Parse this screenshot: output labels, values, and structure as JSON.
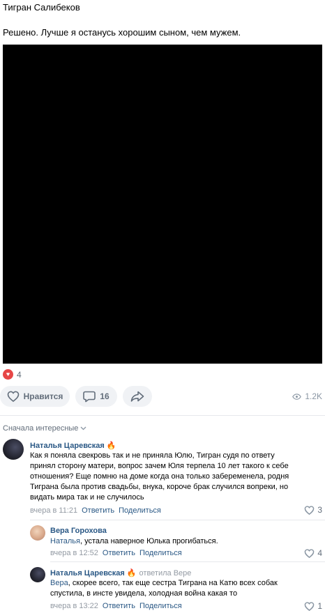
{
  "post": {
    "author": "Тигран Салибеков",
    "text": "Решено. Лучше я останусь хорошим сыном, чем мужем.",
    "reactions_count": "4",
    "like_label": "Нравится",
    "comments_count": "16",
    "views": "1.2K"
  },
  "comments_sort": "Сначала интересные",
  "comments": [
    {
      "name": "Наталья Царевская",
      "badge": "🔥",
      "text_lines": [
        "Как я поняла свекровь так и не приняла Юлю, Тигран судя по ответу",
        "принял сторону матери, вопрос зачем Юля терпела 10 лет такого к себе",
        "отношения? Еще помню на доме когда она только забеременела, родня",
        "Тиграна была против свадьбы, внука, короче брак случился вопреки, но",
        "видать мира так и не случилось"
      ],
      "time": "вчера в 11:21",
      "reply": "Ответить",
      "share": "Поделиться",
      "likes": "3"
    },
    {
      "name": "Вера Горохова",
      "mention": "Наталья",
      "text": ", устала наверное Юлька прогибаться.",
      "time": "вчера в 12:52",
      "reply": "Ответить",
      "share": "Поделиться",
      "likes": "4"
    },
    {
      "name": "Наталья Царевская",
      "badge": "🔥",
      "replied": "ответила Вере",
      "mention": "Вера",
      "text_line1": ", скорее всего, так еще сестра Тиграна на Катю всех собак",
      "text_line2": "спустила, в инсте увидела, холодная война какая то",
      "time": "вчера в 13:22",
      "reply": "Ответить",
      "share": "Поделиться",
      "likes": "1"
    }
  ],
  "colors": {
    "accent": "#2a5885",
    "muted": "#626d7a",
    "reaction": "#e64646"
  }
}
